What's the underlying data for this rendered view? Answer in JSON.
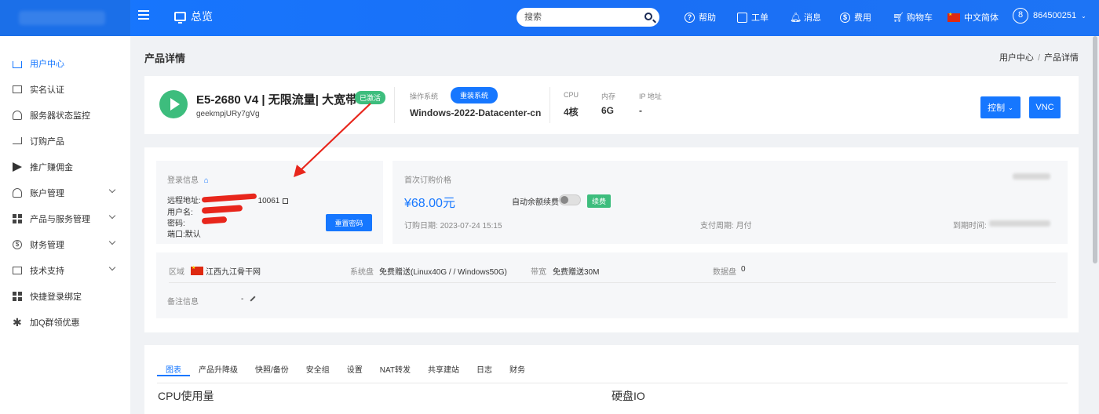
{
  "topbar": {
    "home_label": "总览",
    "search_placeholder": "搜索",
    "nav": [
      {
        "label": "帮助",
        "icon": "help-icon"
      },
      {
        "label": "工单",
        "icon": "ticket-icon"
      },
      {
        "label": "消息",
        "icon": "bell-icon"
      },
      {
        "label": "费用",
        "icon": "dollar-icon"
      },
      {
        "label": "购物车",
        "icon": "cart-icon"
      },
      {
        "label": "中文简体",
        "icon": "china-flag-icon"
      }
    ],
    "user_badge": "8",
    "user_id": "864500251"
  },
  "sidebar": {
    "items": [
      {
        "label": "用户中心",
        "icon": "home-icon",
        "active": true
      },
      {
        "label": "实名认证",
        "icon": "id-card-icon"
      },
      {
        "label": "服务器状态监控",
        "icon": "bell-icon"
      },
      {
        "label": "订购产品",
        "icon": "cart-icon"
      },
      {
        "label": "推广赚佣金",
        "icon": "send-icon"
      },
      {
        "label": "账户管理",
        "icon": "user-icon",
        "expandable": true
      },
      {
        "label": "产品与服务管理",
        "icon": "grid-icon",
        "expandable": true
      },
      {
        "label": "财务管理",
        "icon": "dollar-icon",
        "expandable": true
      },
      {
        "label": "技术支持",
        "icon": "list-icon",
        "expandable": true
      },
      {
        "label": "快捷登录绑定",
        "icon": "grid-icon"
      },
      {
        "label": "加Q群领优惠",
        "icon": "asterisk-icon"
      }
    ]
  },
  "page": {
    "title": "产品详情",
    "breadcrumb": [
      "用户中心",
      "产品详情"
    ]
  },
  "product": {
    "name": "E5-2680 V4 | 无限流量| 大宽带",
    "status": "已激活",
    "id": "geekmpjURy7gVg",
    "os_label": "操作系统",
    "os_value": "Windows-2022-Datacenter-cn",
    "reinstall_label": "重装系统",
    "cpu_label": "CPU",
    "cpu_value": "4核",
    "mem_label": "内存",
    "mem_value": "6G",
    "ip_label": "IP 地址",
    "ip_value": "-",
    "control_label": "控制",
    "vnc_label": "VNC"
  },
  "login": {
    "title": "登录信息",
    "remote_label": "远程地址:",
    "remote_port": "10061",
    "username_label": "用户名:",
    "password_label": "密码:",
    "port_label": "端口:",
    "port_value": "默认",
    "reset_label": "重置密码"
  },
  "price": {
    "title": "首次订购价格",
    "value": "¥68.00元",
    "auto_renew_label": "自动余额续费",
    "renew_label": "续费",
    "order_date_label": "订购日期:",
    "order_date": "2023-07-24 15:15",
    "cycle_label": "支付周期:",
    "cycle_value": "月付",
    "expire_label": "到期时间:"
  },
  "info": {
    "region_label": "区域",
    "region_value": "江西九江骨干网",
    "sysdisk_label": "系统盘",
    "sysdisk_value": "免费赠送(Linux40G / / Windows50G)",
    "bandwidth_label": "带宽",
    "bandwidth_value": "免费赠送30M",
    "datadisk_label": "数据盘",
    "datadisk_value": "0",
    "note_label": "备注信息",
    "note_value": "-"
  },
  "tabs": [
    "图表",
    "产品升降级",
    "快照/备份",
    "安全组",
    "设置",
    "NAT转发",
    "共享建站",
    "日志",
    "财务"
  ],
  "sections": {
    "cpu": "CPU使用量",
    "disk": "硬盘IO"
  },
  "colors": {
    "primary": "#1677ff",
    "success": "#3dbd7d",
    "annotation": "#e8261c"
  }
}
